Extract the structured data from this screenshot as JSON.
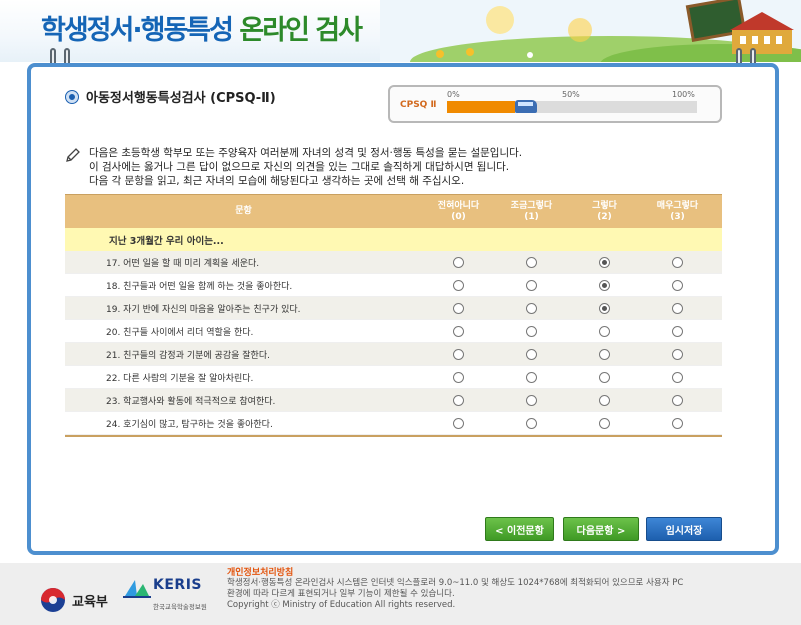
{
  "header": {
    "title_part1": "학생정서·행동특성",
    "title_part2": "온라인 검사"
  },
  "section": {
    "title": "아동정서행동특성검사 (CPSQ-Ⅱ)"
  },
  "progress": {
    "label": "CPSQ Ⅱ",
    "ticks": [
      "0%",
      "50%",
      "100%"
    ],
    "percent": 0.27
  },
  "instructions": {
    "lines": [
      "다음은 초등학생 학부모 또는 주양육자 여러분께 자녀의 성격 및 정서·행동 특성을 묻는 설문입니다.",
      "이 검사에는 옳거나 그른 답이 없으므로 자신의 의견을 있는 그대로 솔직하게 대답하시면 됩니다.",
      "다음 각 문항을 읽고, 최근 자녀의 모습에 해당된다고 생각하는 곳에 선택 해 주십시오."
    ]
  },
  "table": {
    "headers": [
      "문항",
      "전혀아니다\n(0)",
      "조금그렇다\n(1)",
      "그렇다\n(2)",
      "매우그렇다\n(3)"
    ],
    "group_label": "지난 3개월간 우리 아이는...",
    "rows": [
      {
        "text": "17.  어떤 일을 할 때 미리 계획을 세운다.",
        "selected": 2
      },
      {
        "text": "18.  친구들과 어떤 일을 함께 하는 것을 좋아한다.",
        "selected": 2
      },
      {
        "text": "19.  자기 반에 자신의 마음을 알아주는 친구가 있다.",
        "selected": 2
      },
      {
        "text": "20.  친구들 사이에서 리더 역할을 한다.",
        "selected": null
      },
      {
        "text": "21.  친구들의 감정과 기분에 공감을 잘한다.",
        "selected": null
      },
      {
        "text": "22.  다른 사람의 기분을 잘 알아차린다.",
        "selected": null
      },
      {
        "text": "23.  학교행사와 활동에 적극적으로 참여한다.",
        "selected": null
      },
      {
        "text": "24.  호기심이 많고, 탐구하는 것을 좋아한다.",
        "selected": null
      }
    ]
  },
  "buttons": {
    "prev": "< 이전문항",
    "next": "다음문항 >",
    "save": "임시저장"
  },
  "footer": {
    "gov_label": "교육부",
    "keris_word": "KERIS",
    "keris_sub": "한국교육학술정보원",
    "privacy": "개인정보처리방침",
    "notice_lines": [
      "학생정서·행동특성 온라인검사 시스템은 인터넷 익스플로러 9.0~11.0 및 해상도 1024*768에 최적화되어 있으므로 사용자 PC",
      "환경에 따라 다르게 표현되거나 일부 기능이 제한될 수 있습니다.",
      "Copyright ⓒ Ministry of Education All rights reserved."
    ]
  },
  "colors": {
    "accent_blue": "#1565b6",
    "frame_blue": "#4d8fcf",
    "header_tan": "#e8c07f",
    "button_green": "#4fae31",
    "button_blue": "#2a6fc2"
  }
}
